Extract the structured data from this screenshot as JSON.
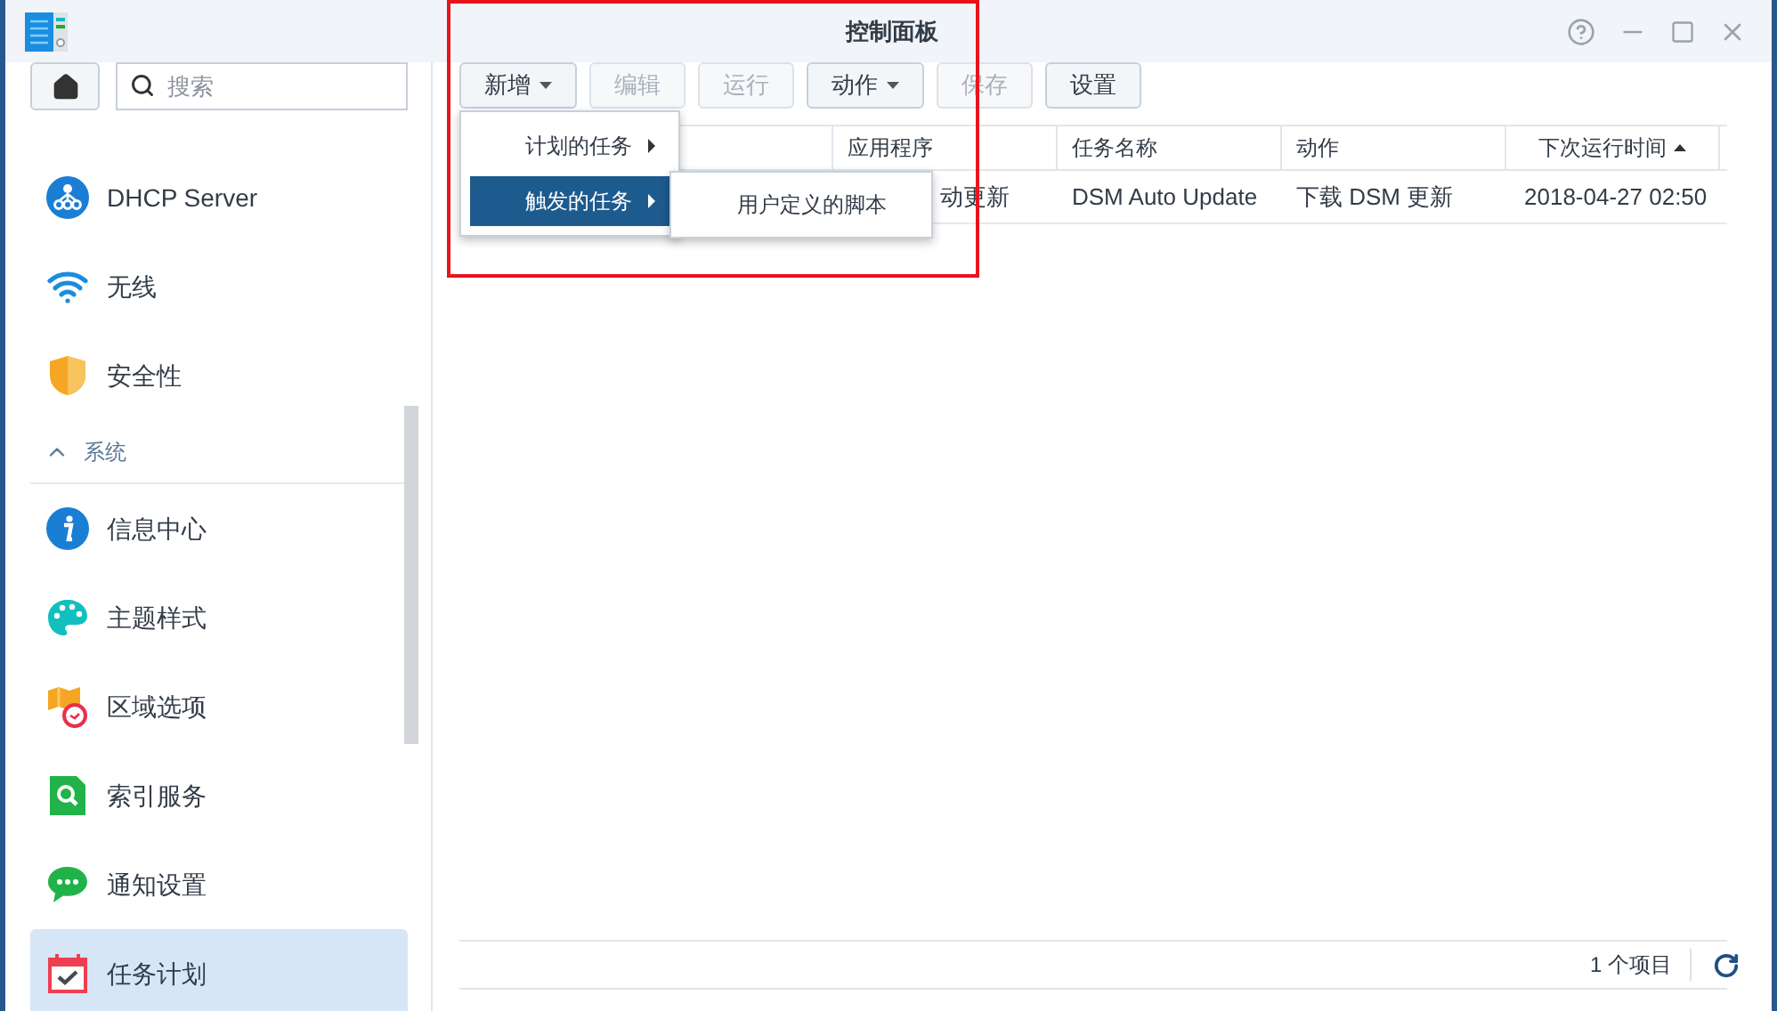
{
  "window": {
    "title": "控制面板"
  },
  "sidebar": {
    "search": {
      "placeholder": "搜索"
    },
    "items": [
      {
        "kind": "item",
        "label": "DHCP Server",
        "selected": false
      },
      {
        "kind": "item",
        "label": "无线",
        "selected": false
      },
      {
        "kind": "item",
        "label": "安全性",
        "selected": false
      },
      {
        "kind": "section",
        "label": "系统",
        "expanded": true
      },
      {
        "kind": "item",
        "label": "信息中心",
        "selected": false
      },
      {
        "kind": "item",
        "label": "主题样式",
        "selected": false
      },
      {
        "kind": "item",
        "label": "区域选项",
        "selected": false
      },
      {
        "kind": "item",
        "label": "索引服务",
        "selected": false
      },
      {
        "kind": "item",
        "label": "通知设置",
        "selected": false
      },
      {
        "kind": "item",
        "label": "任务计划",
        "selected": true
      }
    ]
  },
  "toolbar": [
    {
      "label": "新增",
      "disabled": false,
      "dropdown": true
    },
    {
      "label": "编辑",
      "disabled": true,
      "dropdown": false
    },
    {
      "label": "运行",
      "disabled": true,
      "dropdown": false
    },
    {
      "label": "动作",
      "disabled": false,
      "dropdown": true
    },
    {
      "label": "保存",
      "disabled": true,
      "dropdown": false
    },
    {
      "label": "设置",
      "disabled": false,
      "dropdown": false
    }
  ],
  "menu": [
    {
      "label": "计划的任务",
      "selected": false
    },
    {
      "label": "触发的任务",
      "selected": true,
      "submenu": [
        "用户定义的脚本"
      ]
    }
  ],
  "table": {
    "columns": [
      {
        "label": "应用程序",
        "sorted": false
      },
      {
        "label": "任务名称",
        "sorted": false
      },
      {
        "label": "动作",
        "sorted": false
      },
      {
        "label": "下次运行时间",
        "sorted": true
      }
    ],
    "rows": [
      {
        "cells": [
          "动更新",
          "DSM Auto Update",
          "下载 DSM 更新",
          "2018-04-27 02:50"
        ]
      }
    ]
  },
  "footer": {
    "count": "1 个项目"
  }
}
